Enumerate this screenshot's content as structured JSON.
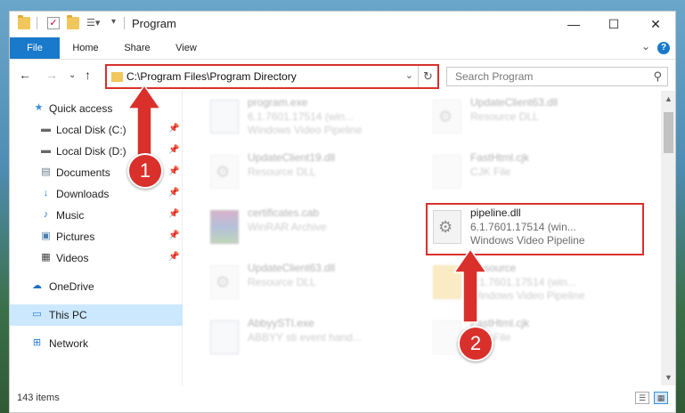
{
  "titlebar": {
    "title": "Program",
    "minimize": "—",
    "maximize": "☐",
    "close": "✕"
  },
  "ribbon": {
    "tabs": [
      "File",
      "Home",
      "Share",
      "View"
    ],
    "help": "?"
  },
  "address": {
    "path": "C:\\Program Files\\Program Directory",
    "search_placeholder": "Search Program"
  },
  "sidebar": {
    "items": [
      {
        "label": "Quick access",
        "icon": "star-icon",
        "pinned": false
      },
      {
        "label": "Local Disk (C:)",
        "icon": "drive-icon",
        "pinned": true
      },
      {
        "label": "Local Disk (D:)",
        "icon": "drive-icon",
        "pinned": true
      },
      {
        "label": "Documents",
        "icon": "documents-icon",
        "pinned": true
      },
      {
        "label": "Downloads",
        "icon": "downloads-icon",
        "pinned": true
      },
      {
        "label": "Music",
        "icon": "music-icon",
        "pinned": true
      },
      {
        "label": "Pictures",
        "icon": "pictures-icon",
        "pinned": true
      },
      {
        "label": "Videos",
        "icon": "videos-icon",
        "pinned": true
      },
      {
        "label": "OneDrive",
        "icon": "onedrive-icon",
        "pinned": false
      },
      {
        "label": "This PC",
        "icon": "pc-icon",
        "pinned": false,
        "selected": true
      },
      {
        "label": "Network",
        "icon": "network-icon",
        "pinned": false
      }
    ]
  },
  "files": [
    {
      "name": "program.exe",
      "line1": "6.1.7601.17514 (win...",
      "line2": "Windows Video Pipeline",
      "type": "exe",
      "blurred": true
    },
    {
      "name": "UpdateClient63.dll",
      "line1": "Resource DLL",
      "line2": "",
      "type": "dll",
      "blurred": true
    },
    {
      "name": "UpdateClient19.dll",
      "line1": "Resource DLL",
      "line2": "",
      "type": "dll",
      "blurred": true
    },
    {
      "name": "FastHtml.cjk",
      "line1": "CJK File",
      "line2": "",
      "type": "dll",
      "blurred": true
    },
    {
      "name": "certificates.cab",
      "line1": "WinRAR Archive",
      "line2": "",
      "type": "rar",
      "blurred": true
    },
    {
      "name": "pipeline.dll",
      "line1": "6.1.7601.17514 (win...",
      "line2": "Windows Video Pipeline",
      "type": "dll",
      "blurred": false
    },
    {
      "name": "UpdateClient63.dll",
      "line1": "Resource DLL",
      "line2": "",
      "type": "dll",
      "blurred": true
    },
    {
      "name": "Resource",
      "line1": "6.1.7601.17514 (win...",
      "line2": "Windows Video Pipeline",
      "type": "folder",
      "blurred": true
    },
    {
      "name": "AbbyySTI.exe",
      "line1": "ABBYY sti event hand...",
      "line2": "",
      "type": "exe",
      "blurred": true
    },
    {
      "name": "FastHtml.cjk",
      "line1": "CJK File",
      "line2": "",
      "type": "dll",
      "blurred": true
    }
  ],
  "status": {
    "count": "143 items"
  },
  "callouts": {
    "one": "1",
    "two": "2"
  },
  "colors": {
    "accent": "#1979ca",
    "highlight": "#d9302c",
    "selected": "#cce8ff"
  }
}
